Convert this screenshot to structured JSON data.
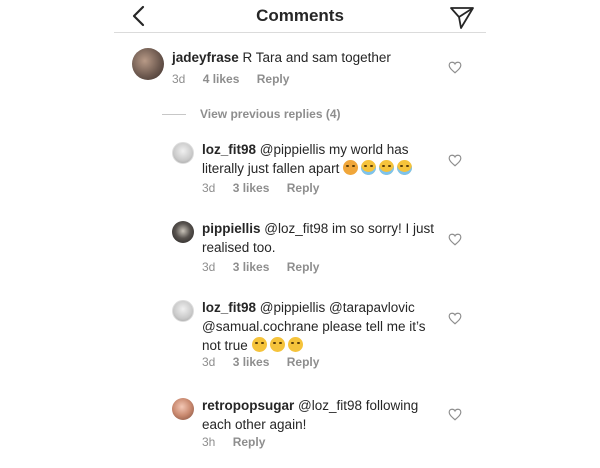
{
  "header": {
    "title": "Comments",
    "back_icon": "chevron-left-icon",
    "send_icon": "paper-plane-icon"
  },
  "comments": [
    {
      "username": "jadeyfrase",
      "text": " R Tara and sam together",
      "time": "3d",
      "likes": "4 likes",
      "reply": "Reply"
    }
  ],
  "view_previous": "View previous replies (4)",
  "replies": [
    {
      "username": "loz_fit98",
      "text": " @pippiellis my world has literally just fallen apart",
      "emojis": [
        "angry-face",
        "crying-face",
        "crying-face",
        "crying-face"
      ],
      "time": "3d",
      "likes": "3 likes",
      "reply": "Reply"
    },
    {
      "username": "pippiellis",
      "text": " @loz_fit98 im so sorry! I just realised too.",
      "time": "3d",
      "likes": "3 likes",
      "reply": "Reply"
    },
    {
      "username": "loz_fit98",
      "text": " @pippiellis @tarapavlovic @samual.cochrane please tell me it’s not true",
      "emojis": [
        "pensive-face",
        "pensive-face",
        "pensive-face"
      ],
      "time": "3d",
      "likes": "3 likes",
      "reply": "Reply"
    },
    {
      "username": "retropopsugar",
      "text": " @loz_fit98 following each other again!",
      "time": "3h",
      "reply": "Reply"
    }
  ],
  "colors": {
    "text": "#262626",
    "meta": "#8e8e8e",
    "divider": "#dbdbdb"
  }
}
